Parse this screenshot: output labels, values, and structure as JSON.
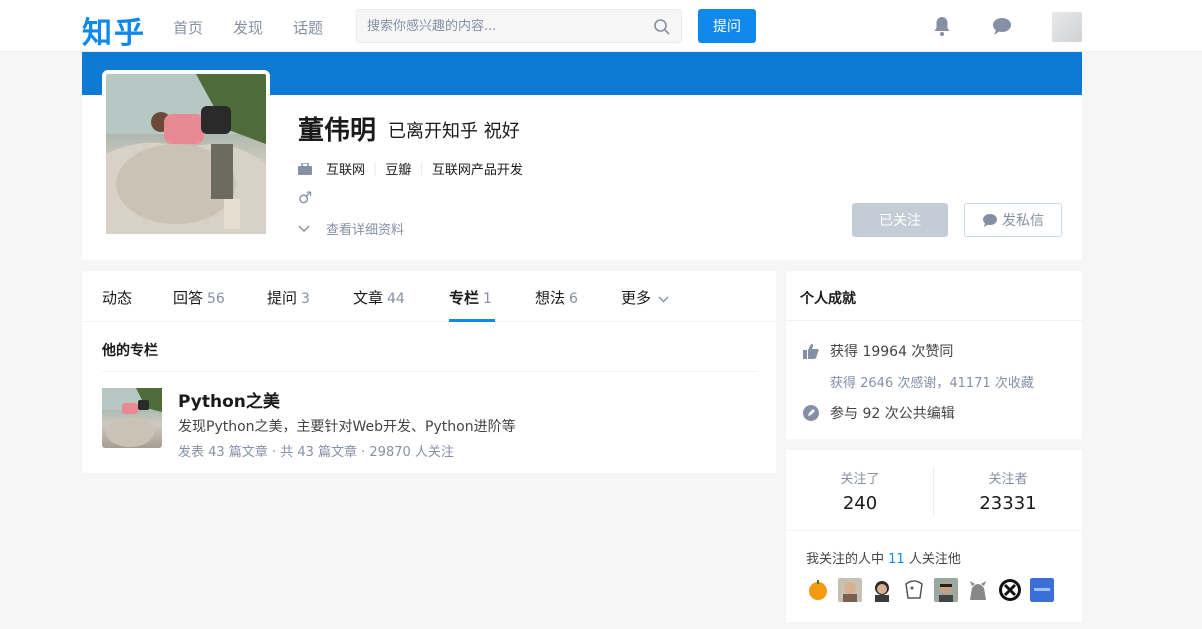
{
  "nav": {
    "logo": "知乎",
    "links": [
      "首页",
      "发现",
      "话题"
    ],
    "search_placeholder": "搜索你感兴趣的内容...",
    "ask_label": "提问",
    "icons": [
      "bell-icon",
      "message-icon"
    ]
  },
  "profile": {
    "name": "董伟明",
    "headline": "已离开知乎 祝好",
    "industry": "互联网",
    "company": "豆瓣",
    "job": "互联网产品开发",
    "gender_symbol": "♂",
    "detail_link": "查看详细资料",
    "followed_label": "已关注",
    "message_label": "发私信",
    "cover_color": "#0f7ad4"
  },
  "tabs": [
    {
      "label": "动态",
      "count": ""
    },
    {
      "label": "回答",
      "count": "56"
    },
    {
      "label": "提问",
      "count": "3"
    },
    {
      "label": "文章",
      "count": "44"
    },
    {
      "label": "专栏",
      "count": "1"
    },
    {
      "label": "想法",
      "count": "6"
    },
    {
      "label": "更多",
      "count": ""
    }
  ],
  "columns": {
    "section_title": "他的专栏",
    "item": {
      "title": "Python之美",
      "desc": "发现Python之美，主要针对Web开发、Python进阶等",
      "meta": "发表 43 篇文章 · 共 43 篇文章 · 29870 人关注"
    }
  },
  "achievements": {
    "title": "个人成就",
    "likes": "获得 19964 次赞同",
    "thanks": "获得 2646 次感谢，41171 次收藏",
    "edits": "参与 92 次公共编辑"
  },
  "follow": {
    "following_label": "关注了",
    "following_count": "240",
    "followers_label": "关注者",
    "followers_count": "23331",
    "mutual_prefix": "我关注的人中",
    "mutual_count": "11",
    "mutual_suffix": "人关注他"
  },
  "colors": {
    "accent": "#0f88eb",
    "muted": "#8590a6"
  }
}
